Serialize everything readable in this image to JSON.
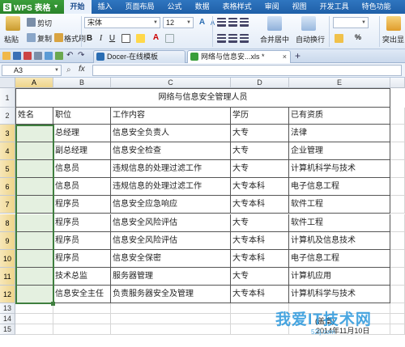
{
  "menubar": {
    "app_name": "WPS 表格",
    "items": [
      "开始",
      "插入",
      "页面布局",
      "公式",
      "数据",
      "表格样式",
      "审阅",
      "视图",
      "开发工具",
      "特色功能"
    ]
  },
  "ribbon": {
    "paste": "粘贴",
    "cut": "剪切",
    "copy": "复制",
    "format_painter": "格式刷",
    "font_name": "宋体",
    "font_size": "12",
    "bold": "B",
    "italic": "I",
    "underline": "U",
    "merge_center": "合并居中",
    "wrap_text": "自动换行",
    "percent": "%",
    "highlight": "突出显"
  },
  "tabs": {
    "docer": "Docer-在线模板",
    "workbook": "网络与信息安...xls *",
    "close": "×",
    "new_tab": "+"
  },
  "formulabar": {
    "cell_ref": "A3",
    "fx": "fx",
    "formula": ""
  },
  "sheet": {
    "columns": [
      "A",
      "B",
      "C",
      "D",
      "E"
    ],
    "rows": [
      "1",
      "2",
      "3",
      "4",
      "5",
      "6",
      "7",
      "8",
      "9",
      "10",
      "11",
      "12",
      "13",
      "14",
      "15"
    ],
    "title": "网络与信息安全管理人员",
    "header": [
      "姓名",
      "职位",
      "工作内容",
      "学历",
      "已有资质"
    ],
    "data": [
      [
        "",
        "总经理",
        "信息安全负责人",
        "大专",
        "法律"
      ],
      [
        "",
        "副总经理",
        "信息安全检查",
        "大专",
        "企业管理"
      ],
      [
        "",
        "信息员",
        "违规信息的处理过滤工作",
        "大专",
        "计算机科学与技术"
      ],
      [
        "",
        "信息员",
        "违规信息的处理过滤工作",
        "大专本科",
        "电子信息工程"
      ],
      [
        "",
        "程序员",
        "信息安全应急响应",
        "大专本科",
        "软件工程"
      ],
      [
        "",
        "程序员",
        "信息安全风险评估",
        "大专",
        "软件工程"
      ],
      [
        "",
        "程序员",
        "信息安全风险评估",
        "大专本科",
        "计算机及信息技术"
      ],
      [
        "",
        "程序员",
        "信息安全保密",
        "大专本科",
        "电子信息工程"
      ],
      [
        "",
        "技术总监",
        "服务器管理",
        "大专",
        "计算机应用"
      ],
      [
        "",
        "信息安全主任",
        "负责服务器安全及管理",
        "大专本科",
        "计算机科学与技术"
      ]
    ],
    "signature_company": "(盖章)",
    "signature_date": "2014年11月10日"
  },
  "watermark": {
    "text": "我爱IT技术网",
    "sub": "52ij.com"
  },
  "colors": {
    "menubar": "#1f5fa8",
    "logo": "#2b842b",
    "selection": "#3f7f3f",
    "header_selected": "#eed48a"
  }
}
